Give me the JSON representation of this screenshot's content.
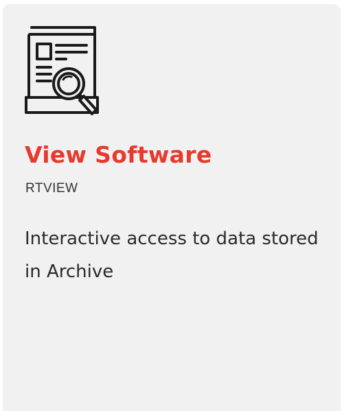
{
  "card": {
    "icon": "document-search-icon",
    "title": "View Software",
    "subtitle": "RTVIEW",
    "description": "Interactive access to data stored in Archive",
    "colors": {
      "title": "#e63a2e",
      "background": "#f1f1f2",
      "icon_stroke": "#1a1a1a"
    }
  }
}
